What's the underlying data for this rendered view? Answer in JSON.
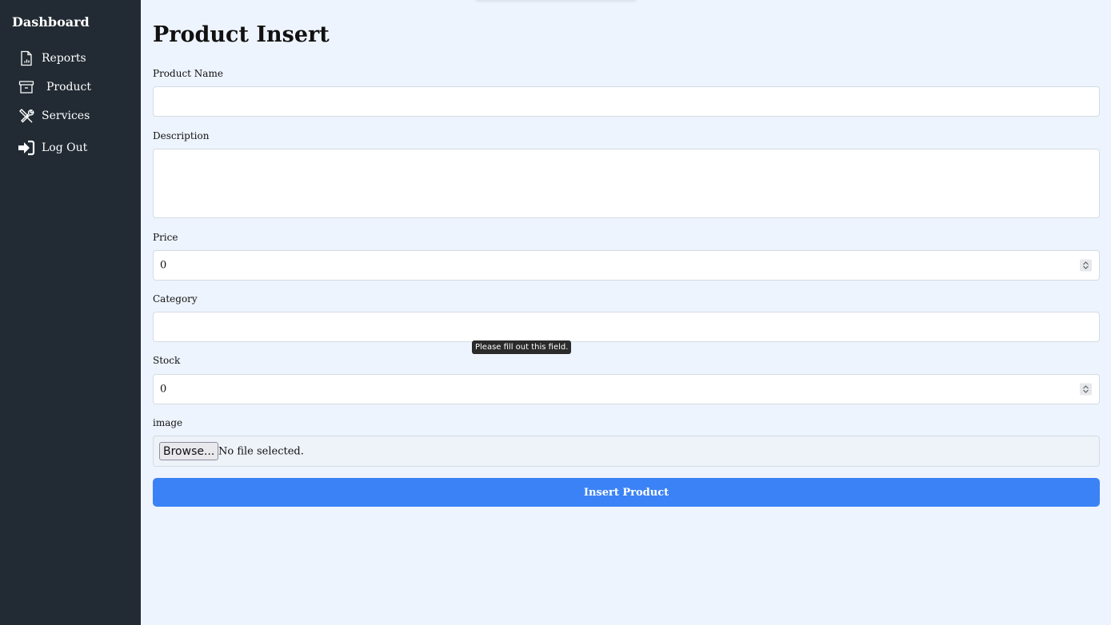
{
  "sidebar": {
    "title": "Dashboard",
    "items": [
      {
        "label": "Reports",
        "icon": "report-document-icon"
      },
      {
        "label": "Product",
        "icon": "archive-box-icon"
      },
      {
        "label": "Services",
        "icon": "tools-icon"
      },
      {
        "label": "Log Out",
        "icon": "sign-in-arrow-icon"
      }
    ]
  },
  "main": {
    "title": "Product Insert",
    "fields": {
      "name": {
        "label": "Product Name",
        "value": ""
      },
      "description": {
        "label": "Description",
        "value": ""
      },
      "price": {
        "label": "Price",
        "value": "0"
      },
      "category": {
        "label": "Category",
        "value": ""
      },
      "stock": {
        "label": "Stock",
        "value": "0"
      },
      "image": {
        "label": "image",
        "button": "Browse...",
        "status": "No file selected."
      }
    },
    "submit_label": "Insert Product",
    "validation_tooltip": "Please fill out this field."
  },
  "colors": {
    "sidebar_bg": "#222b33",
    "page_bg": "#eef4fe",
    "accent": "#3b82f6"
  }
}
